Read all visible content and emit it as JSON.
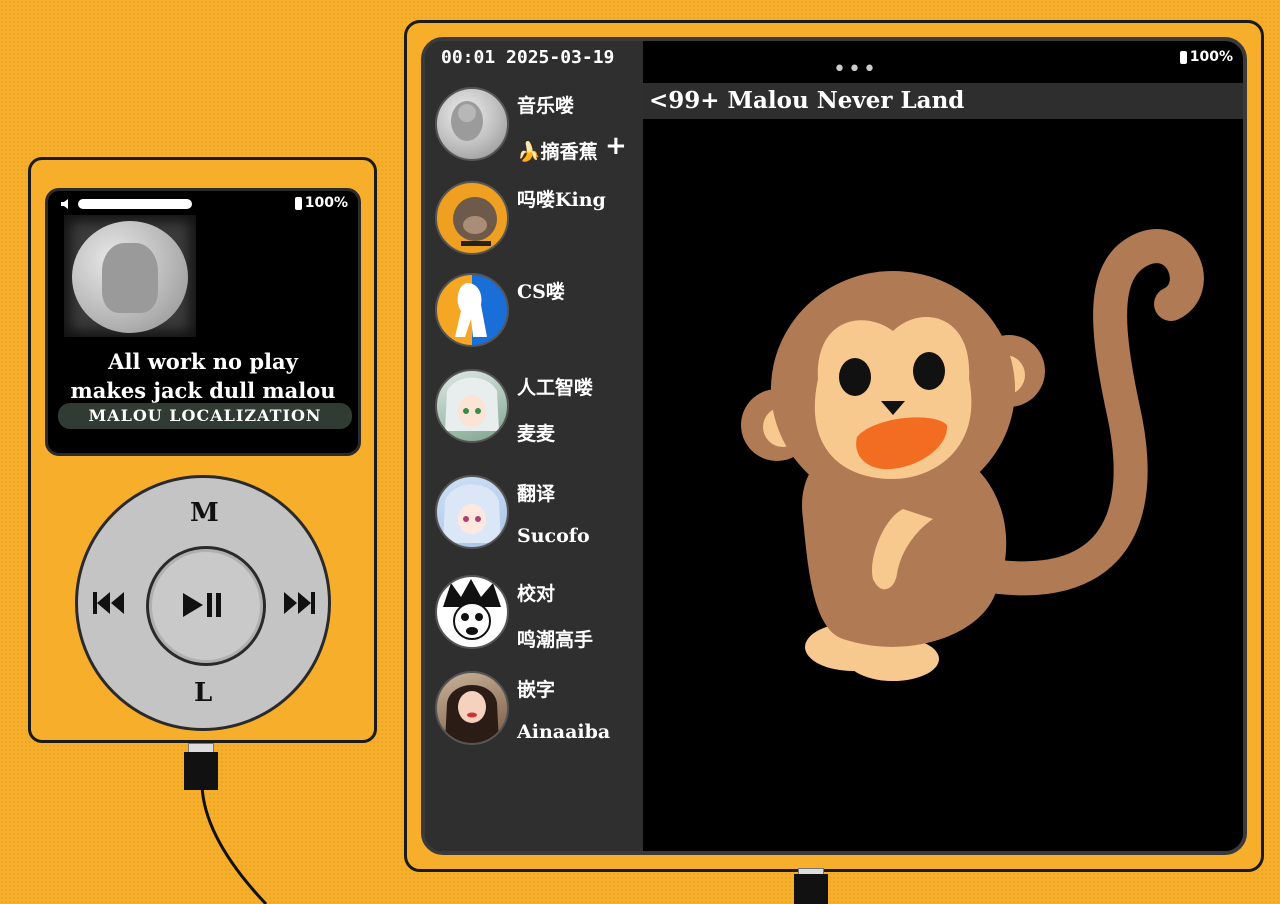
{
  "mp3": {
    "battery": "100%",
    "lyric_line1": "All work no play",
    "lyric_line2": "makes jack dull malou",
    "tag": "MALOU LOCALIZATION",
    "wheel_top": "M",
    "wheel_bottom": "L"
  },
  "tablet": {
    "status_time": "00:01 2025-03-19",
    "battery": "100%",
    "dots": "•••",
    "chat_header": "<99+ Malou Never Land",
    "chats": [
      {
        "name": "音乐喽",
        "sub": "🍌摘香蕉"
      },
      {
        "name": "吗喽King",
        "sub": ""
      },
      {
        "name": "CS喽",
        "sub": ""
      },
      {
        "name": "人工智喽",
        "sub": "麦麦"
      },
      {
        "name": "翻译",
        "sub": "Sucofo"
      },
      {
        "name": "校对",
        "sub": "鸣潮高手"
      },
      {
        "name": "嵌字",
        "sub": "Ainaaiba"
      }
    ],
    "add_symbol": "+"
  },
  "colors": {
    "background": "#f7ae2a",
    "screen": "#000000",
    "sidebar": "#2f2f2f",
    "monkey_body": "#b07a55",
    "monkey_face": "#f7c98f",
    "monkey_mouth": "#f26d21"
  }
}
